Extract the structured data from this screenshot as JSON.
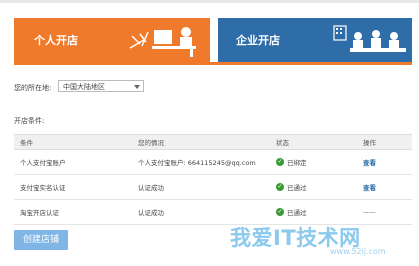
{
  "tabs": {
    "personal": {
      "label": "个人开店"
    },
    "business": {
      "label": "企业开店"
    }
  },
  "region": {
    "label": "您的所在地:",
    "value": "中国大陆地区"
  },
  "conditions": {
    "label": "开店条件:"
  },
  "table": {
    "headers": [
      "条件",
      "您的情况",
      "状态",
      "操作"
    ],
    "rows": [
      {
        "condition": "个人支付宝账户",
        "situation": "个人支付宝账户: 664115245@qq.com",
        "status": "已绑定",
        "action": "查看"
      },
      {
        "condition": "支付宝实名认证",
        "situation": "认证成功",
        "status": "已通过",
        "action": "查看"
      },
      {
        "condition": "淘宝开店认证",
        "situation": "认证成功",
        "status": "已通过",
        "action": "——"
      }
    ]
  },
  "create_button": {
    "label": "创建店铺"
  },
  "watermark": {
    "text": "我爱IT技术网",
    "url": "www.52ij.com"
  },
  "colors": {
    "orange": "#f07a2c",
    "blue": "#2f6da8",
    "green": "#3c9a35",
    "button": "#7fb6e6"
  }
}
